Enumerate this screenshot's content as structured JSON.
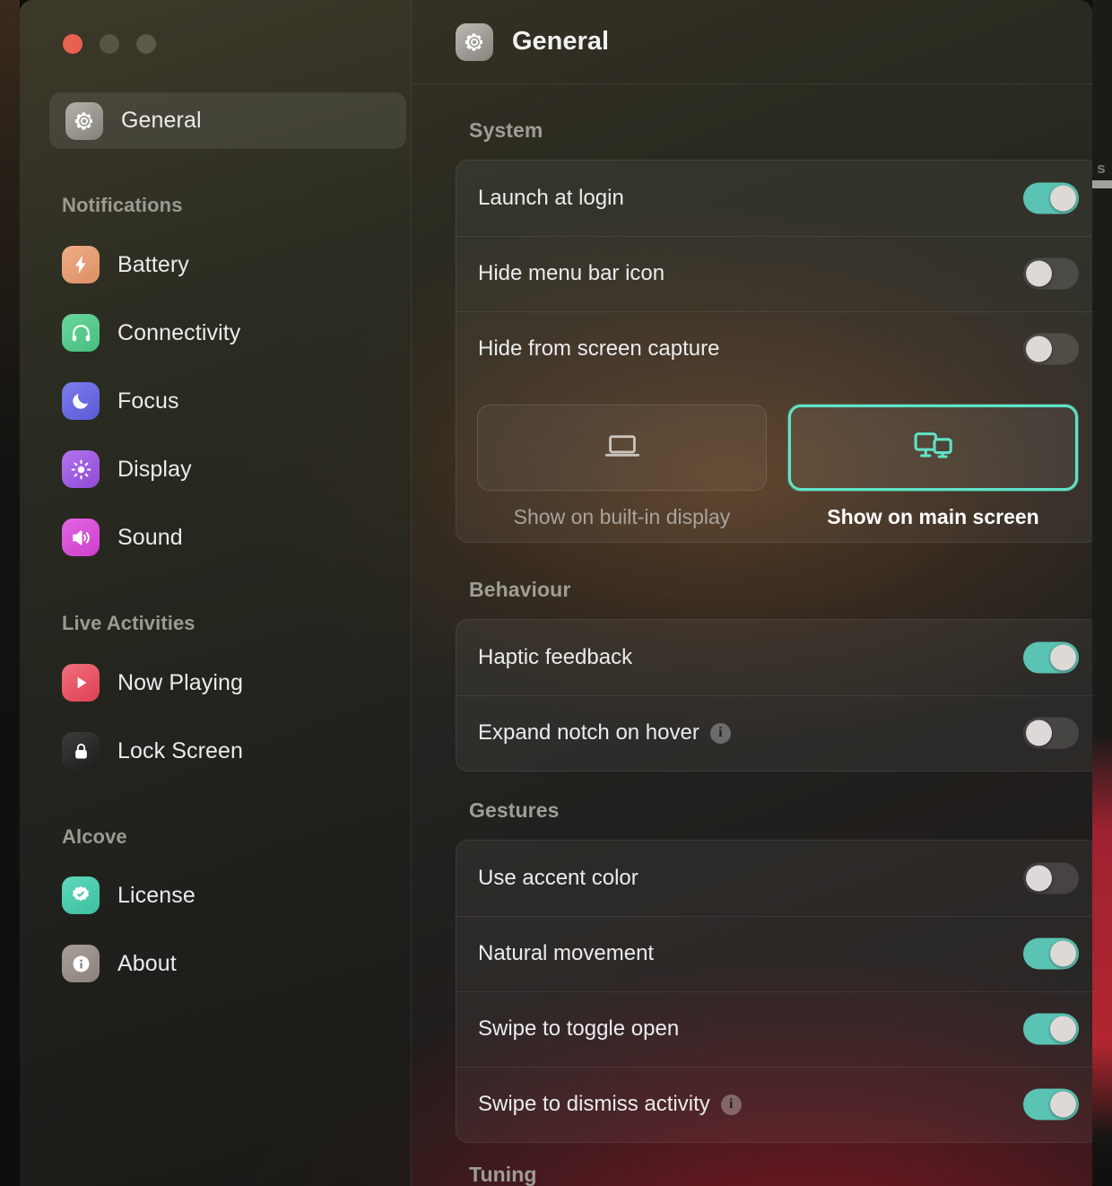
{
  "window": {
    "traffic_lights": [
      "close",
      "minimize",
      "maximize"
    ]
  },
  "sidebar": {
    "selected": {
      "label": "General",
      "icon": "gear-icon"
    },
    "groups": [
      {
        "header": "Notifications",
        "items": [
          {
            "label": "Battery",
            "icon": "battery-bolt-icon",
            "color": "#E49A72"
          },
          {
            "label": "Connectivity",
            "icon": "headphones-icon",
            "color": "#55C98A"
          },
          {
            "label": "Focus",
            "icon": "moon-icon",
            "color": "#6C6CE0"
          },
          {
            "label": "Display",
            "icon": "brightness-icon",
            "color": "#A15CE0"
          },
          {
            "label": "Sound",
            "icon": "speaker-wave-icon",
            "color": "#D84FD8"
          }
        ]
      },
      {
        "header": "Live Activities",
        "items": [
          {
            "label": "Now Playing",
            "icon": "play-circle-icon",
            "color": "#E85565"
          },
          {
            "label": "Lock Screen",
            "icon": "lock-icon",
            "color": "#2E2E2E"
          }
        ]
      },
      {
        "header": "Alcove",
        "items": [
          {
            "label": "License",
            "icon": "seal-check-icon",
            "color": "#4FC9AE"
          },
          {
            "label": "About",
            "icon": "info-circle-icon",
            "color": "#9A9189"
          }
        ]
      }
    ]
  },
  "header": {
    "title": "General",
    "icon": "gear-icon"
  },
  "sections": [
    {
      "header": "System",
      "rows": [
        {
          "label": "Launch at login",
          "toggle": "on",
          "info": false
        },
        {
          "label": "Hide menu bar icon",
          "toggle": "off",
          "info": false
        },
        {
          "label": "Hide from screen capture",
          "toggle": "off",
          "info": false
        }
      ],
      "picker": {
        "options": [
          {
            "label": "Show on built-in display",
            "icon": "laptop-icon",
            "selected": false
          },
          {
            "label": "Show on main screen",
            "icon": "displays-icon",
            "selected": true
          }
        ]
      }
    },
    {
      "header": "Behaviour",
      "rows": [
        {
          "label": "Haptic feedback",
          "toggle": "on",
          "info": false
        },
        {
          "label": "Expand notch on hover",
          "toggle": "off",
          "info": true
        }
      ]
    },
    {
      "header": "Gestures",
      "rows": [
        {
          "label": "Use accent color",
          "toggle": "off",
          "info": false
        },
        {
          "label": "Natural movement",
          "toggle": "on",
          "info": false
        },
        {
          "label": "Swipe to toggle open",
          "toggle": "on",
          "info": false
        },
        {
          "label": "Swipe to dismiss activity",
          "toggle": "on",
          "info": true
        }
      ]
    },
    {
      "header": "Tuning",
      "rows": []
    }
  ],
  "info_glyph": "i",
  "colors": {
    "toggle_on": "#5ac3b4",
    "selection_border": "#5fe3c6",
    "accent_text": "#ffffff"
  },
  "desktop": {
    "background_glyph": "s"
  }
}
